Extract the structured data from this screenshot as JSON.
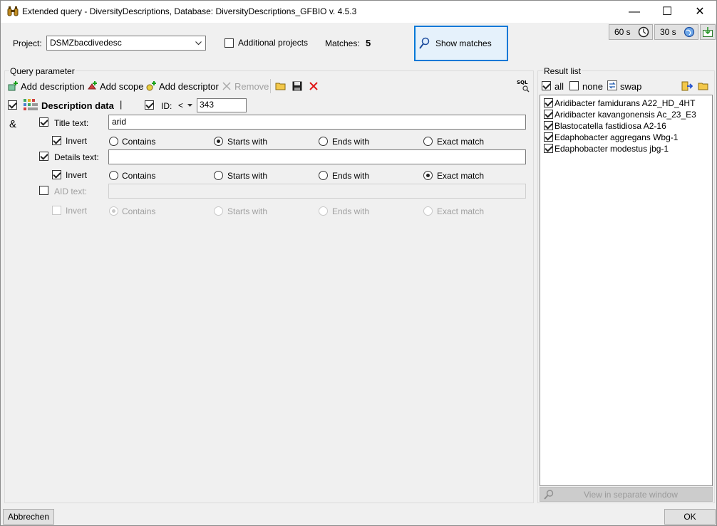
{
  "window": {
    "title": "Extended query - DiversityDescriptions,  Database: DiversityDescriptions_GFBIO    v. 4.5.3",
    "minimize": "—",
    "maximize": "☐",
    "close": "✕"
  },
  "top": {
    "project_label": "Project:",
    "project_value": "DSMZbacdivedesc",
    "additional_projects": "Additional projects",
    "matches_label": "Matches:",
    "matches_value": "5",
    "show_matches": "Show matches",
    "timer1": "60 s",
    "timer2": "30 s"
  },
  "query": {
    "group_label": "Query parameter",
    "toolbar": {
      "add_description": "Add description",
      "add_scope": "Add scope",
      "add_descriptor": "Add descriptor",
      "remove": "Remove",
      "sql": "SQL"
    },
    "description_data": "Description data",
    "separator": "|",
    "id_label": "ID:",
    "id_operator": "<",
    "id_value": "343",
    "ampersand": "&",
    "title_text_label": "Title text:",
    "title_text_value": "arid",
    "details_text_label": "Details text:",
    "details_text_value": "",
    "aid_text_label": "AID text:",
    "aid_text_value": "",
    "invert": "Invert",
    "contains": "Contains",
    "starts_with": "Starts with",
    "ends_with": "Ends with",
    "exact_match": "Exact match"
  },
  "result": {
    "group_label": "Result list",
    "all": "all",
    "none": "none",
    "swap": "swap",
    "items": [
      "Aridibacter famidurans A22_HD_4HT",
      "Aridibacter kavangonensis Ac_23_E3",
      "Blastocatella fastidiosa A2-16",
      "Edaphobacter aggregans Wbg-1",
      "Edaphobacter modestus jbg-1"
    ],
    "view_separate": "View in separate window"
  },
  "footer": {
    "cancel": "Abbrechen",
    "ok": "OK"
  }
}
